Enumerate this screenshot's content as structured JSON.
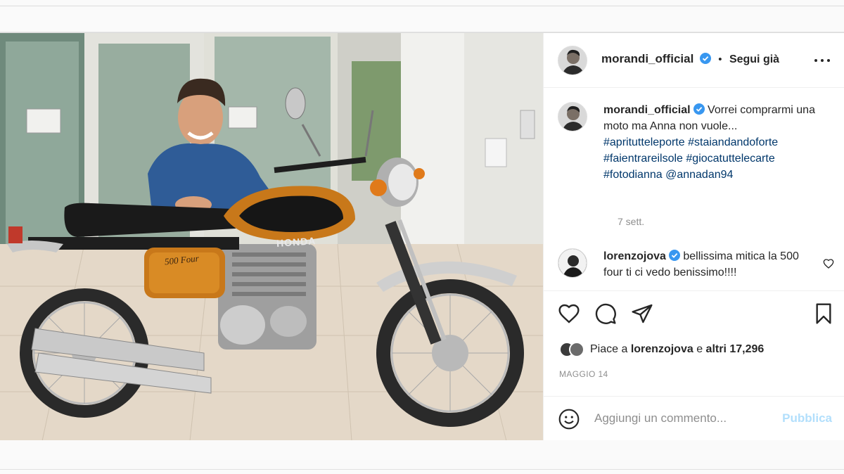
{
  "post": {
    "author": {
      "username": "morandi_official",
      "verified": true,
      "follow_status": "Segui già",
      "avatar_icon": "user-avatar"
    },
    "caption": {
      "username": "morandi_official",
      "text": "Vorrei comprarmi una moto ma Anna non vuole...",
      "hashtags": [
        "#aprituttelepor​te",
        "#staiandandoforte",
        "#faientrareilsole",
        "#giocatuttelecarte",
        "#fotodianna"
      ],
      "mention": "@annadan94",
      "time": "7 sett."
    },
    "comment": {
      "username": "lorenzojova",
      "verified": true,
      "text": "bellissima mitica la 500 four ti ci vedo benissimo!!!!"
    },
    "likes": {
      "prefix": "Piace a",
      "liker": "lorenzojova",
      "joiner": "e",
      "others": "altri 17,296"
    },
    "date": "MAGGIO 14",
    "add_comment": {
      "placeholder": "Aggiungi un commento...",
      "publish_label": "Pubblica"
    },
    "photo": {
      "tank_brand": "HONDA",
      "side_badge": "500 Four"
    }
  },
  "colors": {
    "verified": "#3897f0",
    "hashtag": "#00376b",
    "muted": "#8e8e8e",
    "publish_disabled": "#b2dffc",
    "text": "#262626"
  }
}
